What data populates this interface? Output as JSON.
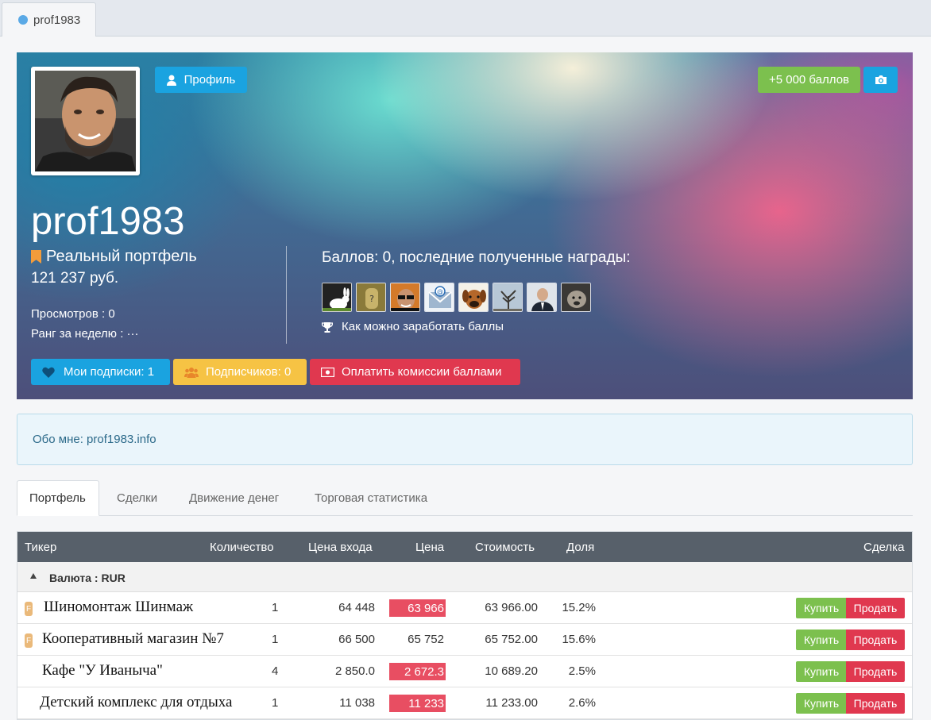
{
  "window": {
    "tab_label": "prof1983"
  },
  "header": {
    "profile_button": "Профиль",
    "points_button": "+5 000 баллов",
    "camera_icon": "camera-icon",
    "username": "prof1983",
    "portfolio_label": "Реальный портфель",
    "portfolio_amount": "121 237 руб.",
    "views": "Просмотров : 0",
    "rank": "Ранг за неделю : ···",
    "awards_title": "Баллов: 0, последние полученные награды:",
    "awards_count": 8,
    "earn_link": "Как можно заработать баллы",
    "subscriptions_button": "Мои подписки: 1",
    "followers_button": "Подписчиков: 0",
    "pay_button": "Оплатить комиссии баллами"
  },
  "about": {
    "text": "Обо мне: prof1983.info"
  },
  "tabs": [
    {
      "label": "Портфель",
      "active": true
    },
    {
      "label": "Сделки"
    },
    {
      "label": "Движение денег"
    },
    {
      "label": "Торговая статистика"
    }
  ],
  "table": {
    "headers": [
      "Тикер",
      "Количество",
      "Цена входа",
      "Цена",
      "Стоимость",
      "Доля",
      "Сделка"
    ],
    "group": "Валюта : RUR",
    "rows": [
      {
        "ticker": "Шиномонтаж Шинмаж",
        "badge": "F",
        "qty": "1",
        "entry": "64 448",
        "price": "63 966",
        "price_down": true,
        "value": "63 966.00",
        "share": "15.2%"
      },
      {
        "ticker": "Кооперативный магазин №7",
        "badge": "F",
        "qty": "1",
        "entry": "66 500",
        "price": "65 752",
        "price_down": false,
        "value": "65 752.00",
        "share": "15.6%"
      },
      {
        "ticker": "Кафе \"У Иваныча\"",
        "badge": "",
        "qty": "4",
        "entry": "2 850.0",
        "price": "2 672.3",
        "price_down": true,
        "value": "10 689.20",
        "share": "2.5%"
      },
      {
        "ticker": "Детский комплекс для отдыха",
        "badge": "",
        "qty": "1",
        "entry": "11 038",
        "price": "11 233",
        "price_down": true,
        "value": "11 233.00",
        "share": "2.6%"
      }
    ],
    "buy_label": "Купить",
    "sell_label": "Продать"
  },
  "colors": {
    "accent_blue": "#1aa3e0",
    "green": "#7cc04e",
    "red": "#e0384f",
    "yellow": "#f6c344"
  }
}
